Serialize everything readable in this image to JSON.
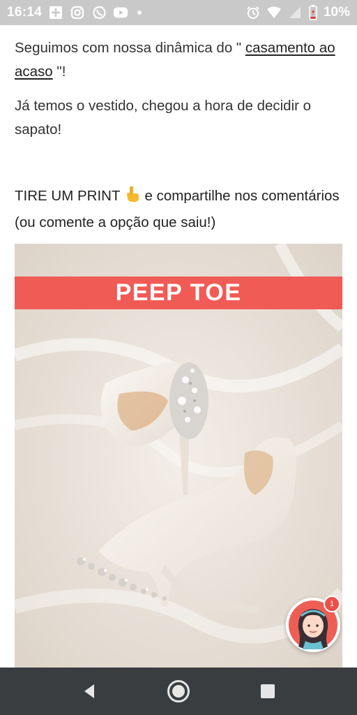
{
  "status_bar": {
    "time": "16:14",
    "battery": "10%",
    "notification_icons": [
      "add-box-icon",
      "instagram-icon",
      "whatsapp-icon",
      "youtube-icon",
      "dot-icon"
    ],
    "system_icons": [
      "alarm-icon",
      "wifi-icon",
      "signal-icon",
      "battery-icon"
    ]
  },
  "post": {
    "p1_before": "Seguimos com nossa dinâmica do \" ",
    "p1_link": "casamento ao acaso",
    "p1_after": " \"!",
    "p2": "Já temos o vestido, chegou a hora de decidir o sapato!",
    "p3_before": "TIRE UM PRINT ",
    "p3_emoji": "👇",
    "p3_after": " e compartilhe nos comentários (ou comente a opção que saiu!)"
  },
  "image": {
    "banner_text": "PEEP TOE",
    "banner_color": "#f15b55"
  },
  "chat": {
    "badge_count": "1"
  },
  "nav": {
    "buttons": [
      "back-icon",
      "home-icon",
      "recents-icon"
    ]
  }
}
